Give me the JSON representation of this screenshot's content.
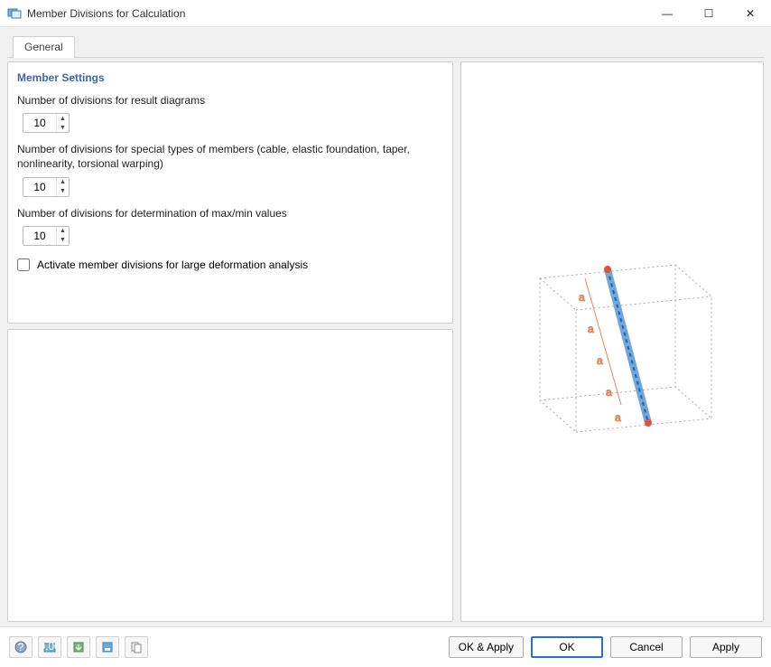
{
  "window": {
    "title": "Member Divisions for Calculation",
    "buttons": {
      "min": "—",
      "max": "☐",
      "close": "✕"
    }
  },
  "tabs": {
    "general": "General"
  },
  "memberSettings": {
    "heading": "Member Settings",
    "divisionsResult": {
      "label": "Number of divisions for result diagrams",
      "value": "10"
    },
    "divisionsSpecial": {
      "label": "Number of divisions for special types of members (cable, elastic foundation, taper, nonlinearity, torsional warping)",
      "value": "10"
    },
    "divisionsMaxMin": {
      "label": "Number of divisions for determination of max/min values",
      "value": "10"
    },
    "activateLargeDef": {
      "label": "Activate member divisions for large deformation analysis",
      "checked": false
    }
  },
  "footer": {
    "okApply": "OK & Apply",
    "ok": "OK",
    "cancel": "Cancel",
    "apply": "Apply"
  },
  "icons": {
    "help": "help-icon",
    "units": "units-icon",
    "import": "import-icon",
    "save": "save-icon",
    "copy": "copy-icon"
  }
}
